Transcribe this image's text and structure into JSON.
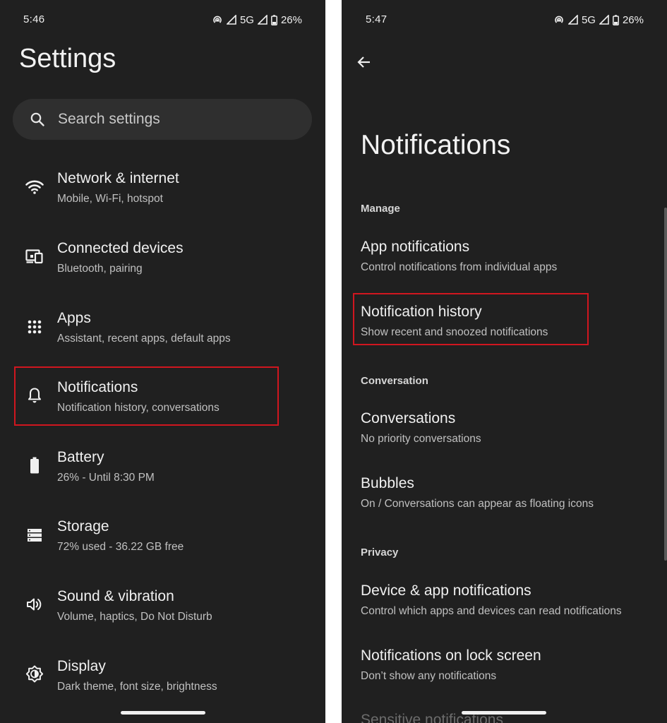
{
  "left_screen": {
    "status": {
      "time": "5:46",
      "network": "5G",
      "battery": "26%"
    },
    "title": "Settings",
    "search": {
      "placeholder": "Search settings"
    },
    "items": [
      {
        "title": "Network & internet",
        "subtitle": "Mobile, Wi-Fi, hotspot",
        "icon": "wifi-icon"
      },
      {
        "title": "Connected devices",
        "subtitle": "Bluetooth, pairing",
        "icon": "devices-icon"
      },
      {
        "title": "Apps",
        "subtitle": "Assistant, recent apps, default apps",
        "icon": "apps-grid-icon"
      },
      {
        "title": "Notifications",
        "subtitle": "Notification history, conversations",
        "icon": "bell-icon",
        "highlighted": true
      },
      {
        "title": "Battery",
        "subtitle": "26% - Until 8:30 PM",
        "icon": "battery-icon"
      },
      {
        "title": "Storage",
        "subtitle": "72% used - 36.22 GB free",
        "icon": "storage-icon"
      },
      {
        "title": "Sound & vibration",
        "subtitle": "Volume, haptics, Do Not Disturb",
        "icon": "speaker-icon"
      },
      {
        "title": "Display",
        "subtitle": "Dark theme, font size, brightness",
        "icon": "brightness-icon"
      }
    ]
  },
  "right_screen": {
    "status": {
      "time": "5:47",
      "network": "5G",
      "battery": "26%"
    },
    "title": "Notifications",
    "sections": {
      "manage": "Manage",
      "conversation": "Conversation",
      "privacy": "Privacy"
    },
    "items": [
      {
        "title": "App notifications",
        "subtitle": "Control notifications from individual apps"
      },
      {
        "title": "Notification history",
        "subtitle": "Show recent and snoozed notifications",
        "highlighted": true
      },
      {
        "title": "Conversations",
        "subtitle": "No priority conversations"
      },
      {
        "title": "Bubbles",
        "subtitle": "On / Conversations can appear as floating icons"
      },
      {
        "title": "Device & app notifications",
        "subtitle": "Control which apps and devices can read notifications"
      },
      {
        "title": "Notifications on lock screen",
        "subtitle": "Don’t show any notifications"
      }
    ],
    "partial_item": "Sensitive notifications"
  },
  "colors": {
    "background": "#202020",
    "search_bg": "#2f2f2f",
    "highlight": "#d0161f",
    "text_primary": "#f0f0f0",
    "text_secondary": "#c0c0c0"
  }
}
